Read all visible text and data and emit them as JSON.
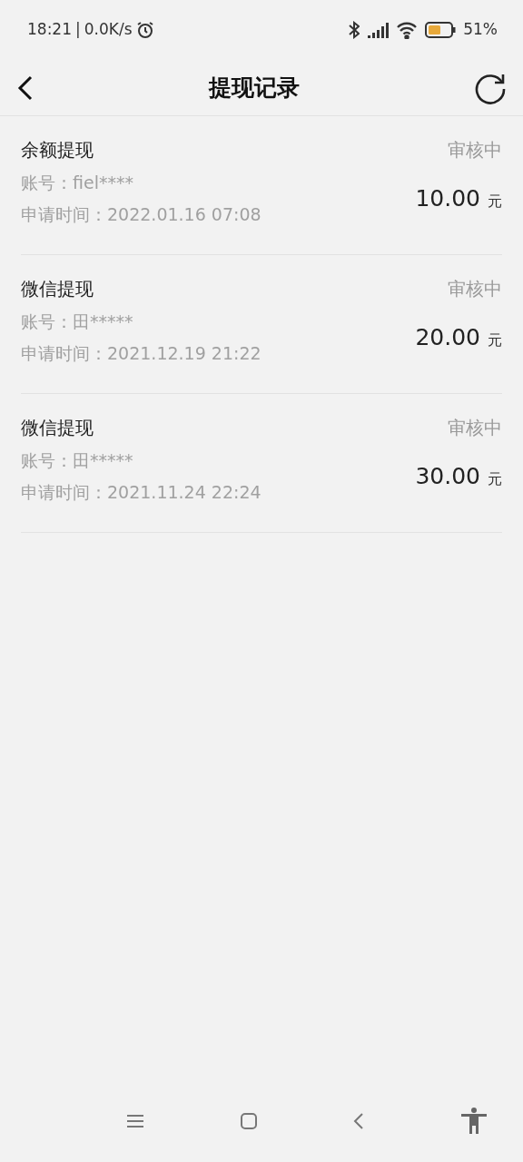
{
  "status_bar": {
    "time": "18:21",
    "separator": "|",
    "speed": "0.0K/s",
    "battery": "51%"
  },
  "header": {
    "title": "提现记录"
  },
  "records": [
    {
      "title": "余额提现",
      "status": "审核中",
      "account": "账号：fiel****",
      "time": "申请时间：2022.01.16 07:08",
      "amount": "10.00",
      "unit": "元"
    },
    {
      "title": "微信提现",
      "status": "审核中",
      "account": "账号：田*****",
      "time": "申请时间：2021.12.19 21:22",
      "amount": "20.00",
      "unit": "元"
    },
    {
      "title": "微信提现",
      "status": "审核中",
      "account": "账号：田*****",
      "time": "申请时间：2021.11.24 22:24",
      "amount": "30.00",
      "unit": "元"
    }
  ]
}
